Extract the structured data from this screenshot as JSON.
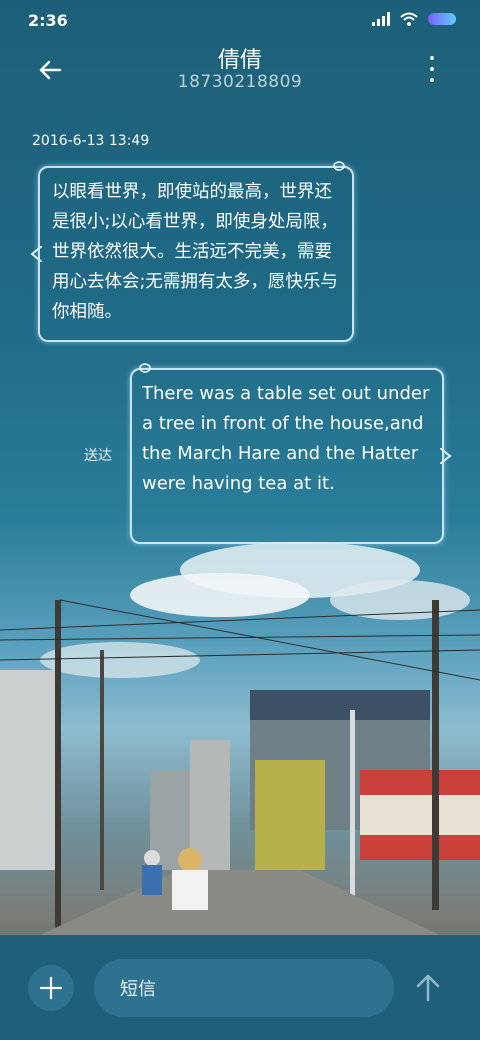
{
  "status_bar": {
    "time": "2:36"
  },
  "header": {
    "contact_name": "倩倩",
    "phone_number": "18730218809"
  },
  "conversation": {
    "timestamp": "2016-6-13 13:49",
    "messages": [
      {
        "direction": "incoming",
        "text": "以眼看世界，即使站的最高，世界还是很小;以心看世界，即使身处局限，世界依然很大。生活远不完美，需要用心去体会;无需拥有太多，愿快乐与你相随。"
      },
      {
        "direction": "outgoing",
        "text": "There was a table set out under a tree in front of the house,and the March Hare and the Hatter were having tea at it.",
        "status": "送达"
      }
    ]
  },
  "composer": {
    "placeholder": "短信"
  },
  "colors": {
    "accent_bar": "#1f5f79",
    "bubble_border": "#dcf0ff"
  },
  "icons": [
    "back-arrow-icon",
    "more-vertical-icon",
    "signal-icon",
    "wifi-icon",
    "battery-icon",
    "plus-icon",
    "send-arrow-icon"
  ]
}
